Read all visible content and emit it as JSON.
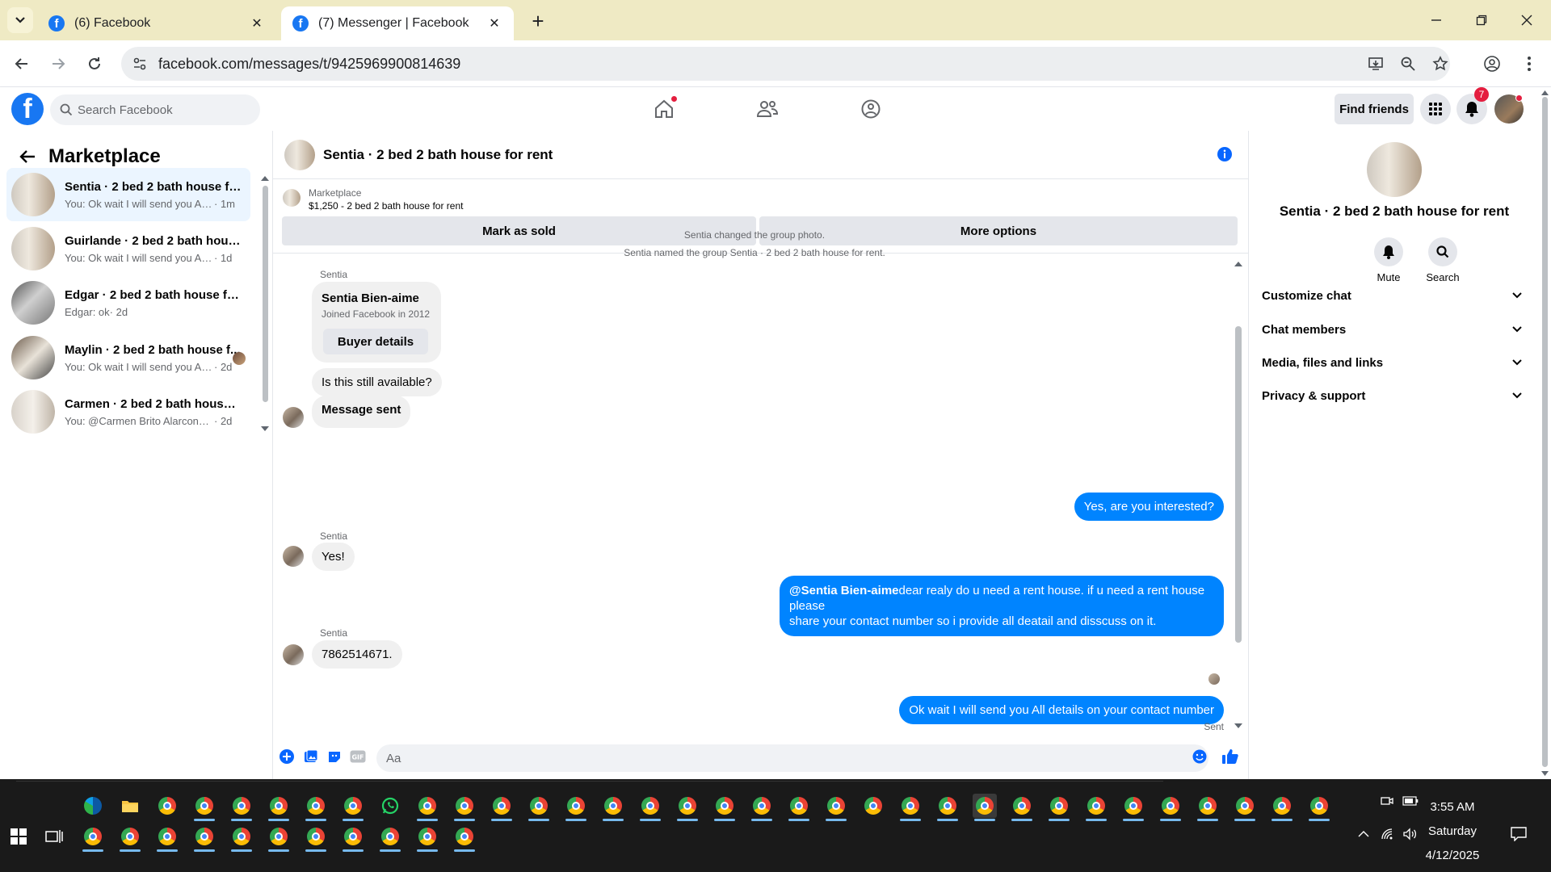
{
  "browser": {
    "tabs": [
      {
        "title": "(6) Facebook"
      },
      {
        "title": "(7) Messenger | Facebook"
      }
    ],
    "url": "facebook.com/messages/t/9425969900814639"
  },
  "fb": {
    "search_placeholder": "Search Facebook",
    "find_friends": "Find friends",
    "notifications_count": "7"
  },
  "sidebar": {
    "title": "Marketplace",
    "conversations": [
      {
        "name": "Sentia · 2 bed 2 bath house for ...",
        "preview": "You: Ok wait I will send you All de...",
        "time": "· 1m"
      },
      {
        "name": "Guirlande · 2 bed 2 bath house ...",
        "preview": "You: Ok wait I will send you All det...",
        "time": "· 1d"
      },
      {
        "name": "Edgar · 2 bed 2 bath house for r...",
        "preview": "Edgar: ok",
        "time": "· 2d"
      },
      {
        "name": "Maylin · 2 bed 2 bath house f...",
        "preview": "You: Ok wait I will send you All ...",
        "time": "· 2d"
      },
      {
        "name": "Carmen · 2 bed 2 bath house fo...",
        "preview": "You: @Carmen Brito AlarconHola, ...",
        "time": "· 2d"
      }
    ]
  },
  "chat": {
    "title": "Sentia · 2 bed 2 bath house for rent",
    "listing": {
      "label": "Marketplace",
      "detail": "$1,250 - 2 bed 2 bath house for rent",
      "mark_sold": "Mark as sold",
      "more_options": "More options"
    },
    "system_messages": [
      "Sentia changed the group photo.",
      "Sentia named the group Sentia · 2 bed 2 bath house for rent."
    ],
    "buyer_card": {
      "sender": "Sentia",
      "name": "Sentia Bien-aime",
      "joined": "Joined Facebook in 2012",
      "button": "Buyer details"
    },
    "messages": {
      "in_1": "Is this still available?",
      "in_2": "Message sent",
      "out_1": "Yes, are you interested?",
      "sender_2": "Sentia",
      "in_3": "Yes!",
      "out_2_mention": "@Sentia Bien-aime",
      "out_2_line1": "dear realy do u need a rent house. if u need a rent house please",
      "out_2_line2": "share your contact number so i provide all deatail and disscuss on it.",
      "sender_3": "Sentia",
      "in_4": "7862514671.",
      "out_3": "Ok wait I will send you All details on your contact number",
      "status": "Sent"
    },
    "composer_placeholder": "Aa"
  },
  "right_panel": {
    "name": "Sentia · 2 bed 2 bath house for rent",
    "mute": "Mute",
    "search": "Search",
    "sections": [
      "Customize chat",
      "Chat members",
      "Media, files and links",
      "Privacy & support"
    ]
  },
  "taskbar": {
    "time": "3:55 AM",
    "day": "Saturday",
    "date": "4/12/2025"
  },
  "colors": {
    "messenger_blue": "#0084ff",
    "facebook_blue": "#1877f2",
    "tabstrip": "#efeac4"
  }
}
